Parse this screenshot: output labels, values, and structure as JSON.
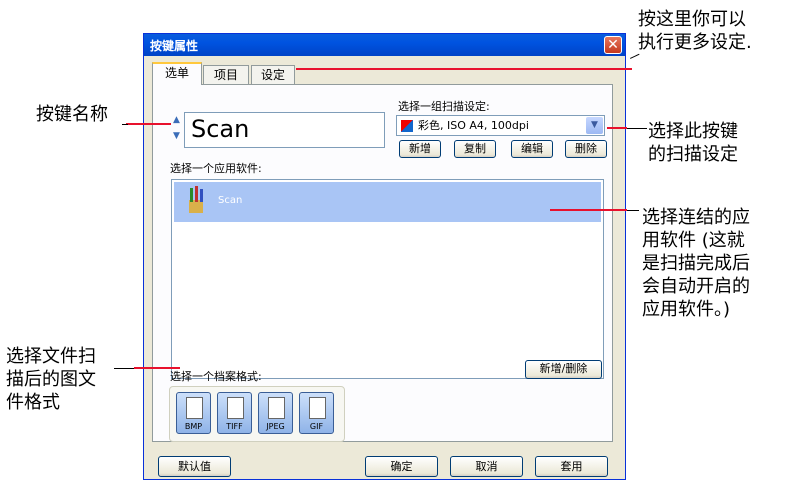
{
  "annotations": {
    "more_settings": "按这里你可以\n执行更多设定.",
    "button_name": "按键名称",
    "scan_setting": "选择此按键\n的扫描设定",
    "linked_app": "选择连结的应\n用软件 (这就\n是扫描完成后\n会自动开启的\n应用软件。)",
    "file_format": "选择文件扫\n描后的图文\n件格式"
  },
  "window": {
    "title": "按键属性",
    "close_glyph": "✕"
  },
  "tabs": [
    "选单",
    "项目",
    "设定"
  ],
  "button_name": {
    "value": "Scan",
    "spin_up": "▲",
    "spin_down": "▼"
  },
  "scan_setting": {
    "label": "选择一组扫描设定:",
    "selected": "彩色, ISO A4, 100dpi",
    "dropdown_glyph": "▼",
    "buttons": [
      "新增",
      "复制",
      "编辑",
      "删除"
    ]
  },
  "app": {
    "label": "选择一个应用软件:",
    "items": [
      {
        "name": "Scan"
      }
    ],
    "add_remove_button": "新增/删除"
  },
  "file_format": {
    "label": "选择一个档案格式:",
    "formats": [
      "BMP",
      "TIFF",
      "JPEG",
      "GIF"
    ]
  },
  "footer": {
    "default": "默认值",
    "ok": "确定",
    "cancel": "取消",
    "apply": "套用"
  },
  "colors": {
    "accent_line": "#e8112d",
    "title_bar": "#0053e0",
    "selection": "#a9c5f5"
  }
}
